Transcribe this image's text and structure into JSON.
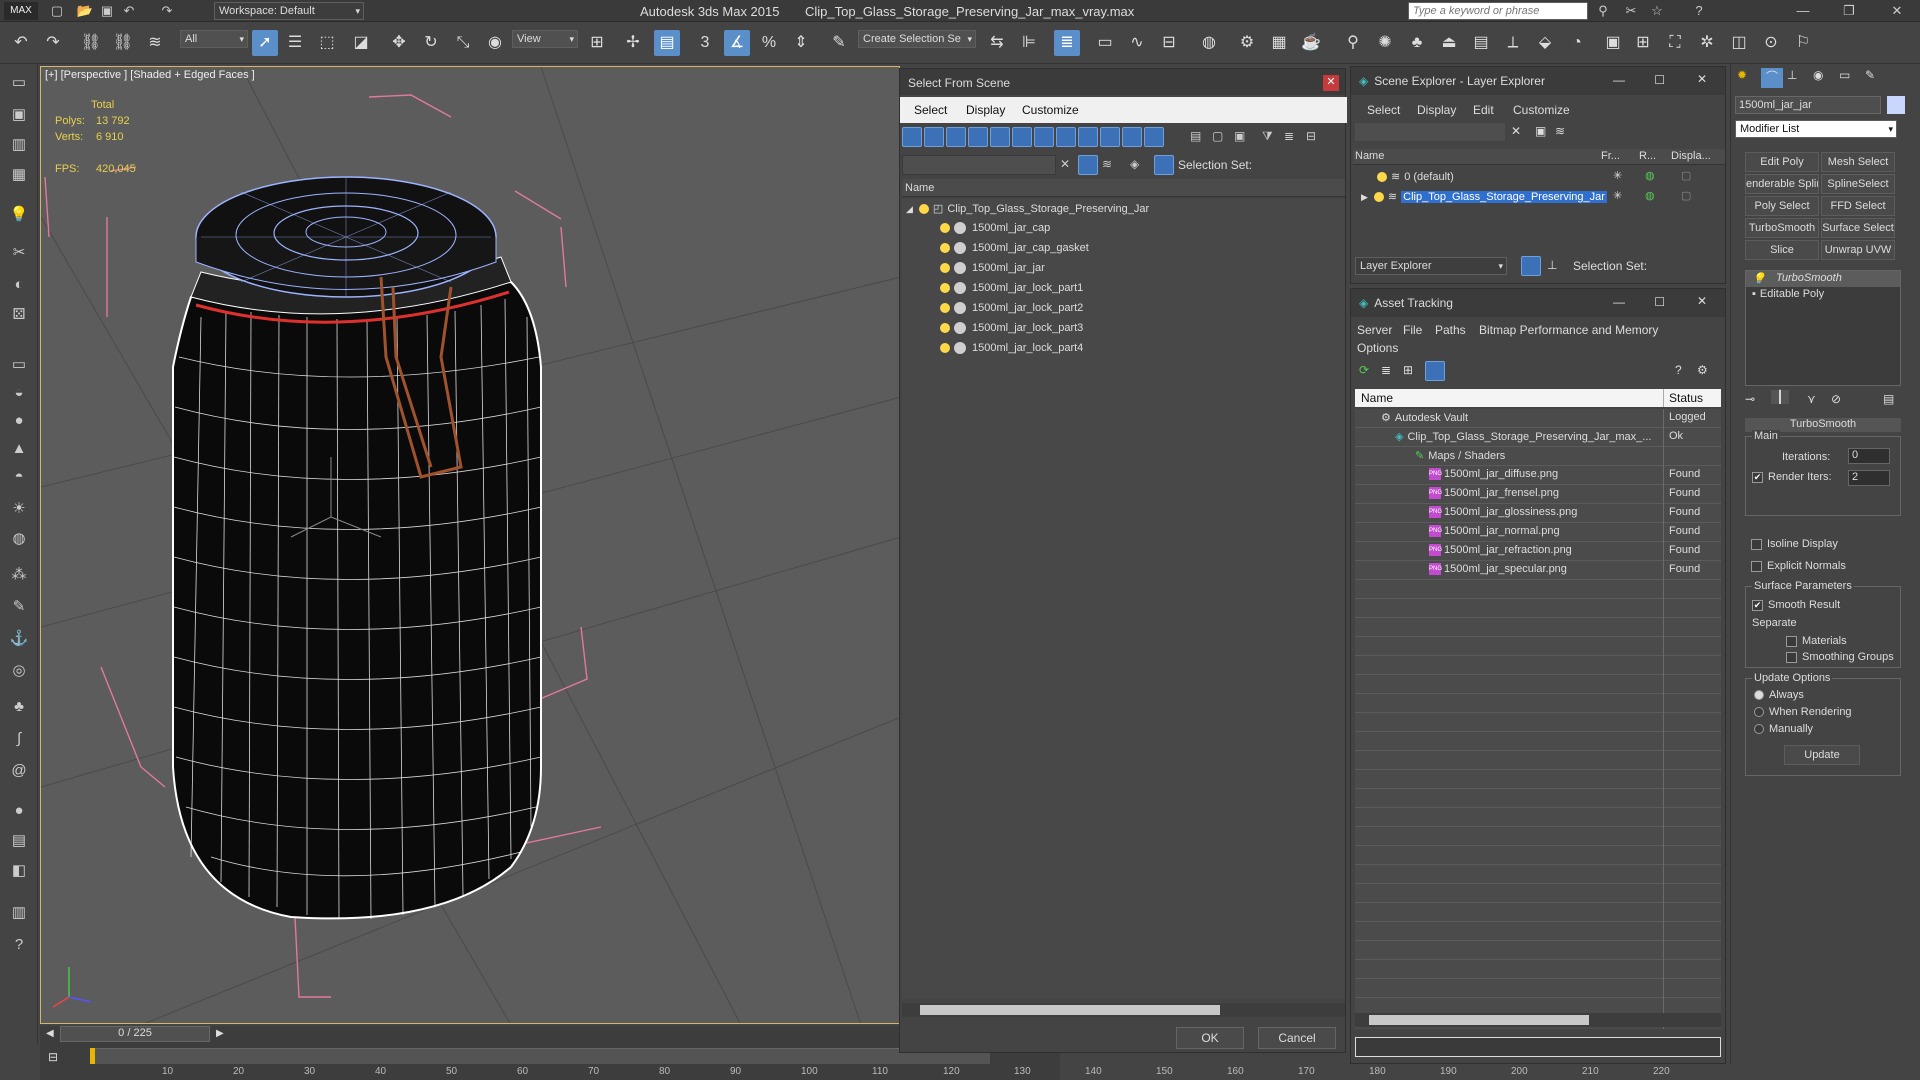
{
  "titlebar": {
    "app": "Autodesk 3ds Max  2015",
    "file": "Clip_Top_Glass_Storage_Preserving_Jar_max_vray.max",
    "workspace": "Workspace: Default",
    "search_placeholder": "Type a keyword or phrase"
  },
  "toolbar": {
    "filter": "All",
    "view": "View",
    "selection_set": "Create Selection Se"
  },
  "viewport": {
    "label": "[+] [Perspective ] [Shaded + Edged Faces ]",
    "total_label": "Total",
    "polys_label": "Polys:",
    "polys": "13 792",
    "verts_label": "Verts:",
    "verts": "6 910",
    "fps_label": "FPS:",
    "fps": "420,045"
  },
  "timeline": {
    "frame": "0 / 225",
    "ticks": [
      "10",
      "20",
      "30",
      "40",
      "50",
      "60",
      "70",
      "80",
      "90",
      "100",
      "110",
      "120",
      "130",
      "140",
      "150",
      "160",
      "170",
      "180",
      "190",
      "200",
      "210",
      "220"
    ]
  },
  "select_from_scene": {
    "title": "Select From Scene",
    "menus": [
      "Select",
      "Display",
      "Customize"
    ],
    "selection_set_label": "Selection Set:",
    "col_name": "Name",
    "root": "Clip_Top_Glass_Storage_Preserving_Jar",
    "items": [
      "1500ml_jar_cap",
      "1500ml_jar_cap_gasket",
      "1500ml_jar_jar",
      "1500ml_jar_lock_part1",
      "1500ml_jar_lock_part2",
      "1500ml_jar_lock_part3",
      "1500ml_jar_lock_part4"
    ],
    "ok": "OK",
    "cancel": "Cancel"
  },
  "scene_explorer": {
    "title": "Scene Explorer - Layer Explorer",
    "menus": [
      "Select",
      "Display",
      "Edit",
      "Customize"
    ],
    "cols": [
      "Name",
      "Fr...",
      "R...",
      "Displa..."
    ],
    "layers": [
      "0 (default)",
      "Clip_Top_Glass_Storage_Preserving_Jar"
    ],
    "footer_dropdown": "Layer Explorer",
    "selection_set_label": "Selection Set:"
  },
  "asset_tracking": {
    "title": "Asset Tracking",
    "menus": [
      "Server",
      "File",
      "Paths",
      "Bitmap Performance and Memory",
      "Options"
    ],
    "cols": [
      "Name",
      "Status"
    ],
    "rows": [
      {
        "name": "Autodesk Vault",
        "status": "Logged"
      },
      {
        "name": "Clip_Top_Glass_Storage_Preserving_Jar_max_...",
        "status": "Ok"
      },
      {
        "name": "Maps / Shaders",
        "status": ""
      },
      {
        "name": "1500ml_jar_diffuse.png",
        "status": "Found"
      },
      {
        "name": "1500ml_jar_frensel.png",
        "status": "Found"
      },
      {
        "name": "1500ml_jar_glossiness.png",
        "status": "Found"
      },
      {
        "name": "1500ml_jar_normal.png",
        "status": "Found"
      },
      {
        "name": "1500ml_jar_refraction.png",
        "status": "Found"
      },
      {
        "name": "1500ml_jar_specular.png",
        "status": "Found"
      }
    ]
  },
  "command_panel": {
    "object_name": "1500ml_jar_jar",
    "modifier_list": "Modifier List",
    "buttons": [
      "Edit Poly",
      "Mesh Select",
      "enderable Splir",
      "SplineSelect",
      "Poly Select",
      "FFD Select",
      "TurboSmooth",
      "Surface Select",
      "Slice",
      "Unwrap UVW"
    ],
    "stack": [
      "TurboSmooth",
      "Editable Poly"
    ],
    "rollout_title": "TurboSmooth",
    "main": "Main",
    "iterations_label": "Iterations:",
    "iterations": "0",
    "render_iters_label": "Render Iters:",
    "render_iters": "2",
    "isoline": "Isoline Display",
    "explicit_normals": "Explicit Normals",
    "surface_params": "Surface Parameters",
    "smooth_result": "Smooth Result",
    "separate": "Separate",
    "materials": "Materials",
    "smoothing_groups": "Smoothing Groups",
    "update_options": "Update Options",
    "always": "Always",
    "when_rendering": "When Rendering",
    "manually": "Manually",
    "update": "Update"
  }
}
